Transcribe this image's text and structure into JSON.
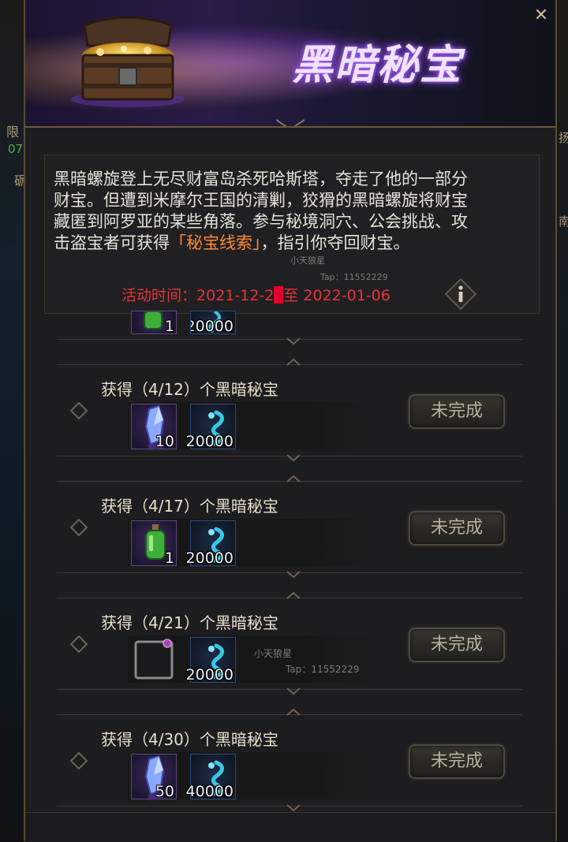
{
  "banner": {
    "title": "黑暗秘宝"
  },
  "background": {
    "left_fragments": [
      "限",
      "07",
      "砺"
    ],
    "right_fragments": [
      "扬",
      "南"
    ]
  },
  "description": {
    "part1": "黑暗螺旋登上无尽财富岛杀死哈斯塔，夺走了他的一部分财宝。但遭到米摩尔王国的清剿，狡猾的黑暗螺旋将财宝藏匿到阿罗亚的某些角落。参与秘境洞穴、公会挑战、攻击盗宝者可获得",
    "highlight": "「秘宝线索」",
    "part2": "，指引你夺回财宝。"
  },
  "event_time": {
    "label": "活动时间：",
    "start": "2021-12-2",
    "separator": "至",
    "end": "2022-01-06"
  },
  "watermarks": [
    {
      "name": "小天狼星",
      "tap": "Tap：11552229"
    },
    {
      "name": "小天狼星",
      "tap": "Tap：11552229"
    }
  ],
  "partial_row": {
    "items": [
      {
        "icon": "green-potion-icon",
        "count": "1"
      },
      {
        "icon": "blue-spirit-icon",
        "count": "20000"
      }
    ]
  },
  "tasks": [
    {
      "title": "获得（4/12）个黑暗秘宝",
      "status": "未完成",
      "items": [
        {
          "icon": "crystal-icon",
          "count": "10"
        },
        {
          "icon": "blue-spirit-icon",
          "count": "20000"
        }
      ]
    },
    {
      "title": "获得（4/17）个黑暗秘宝",
      "status": "未完成",
      "items": [
        {
          "icon": "green-potion-icon",
          "count": "1"
        },
        {
          "icon": "blue-spirit-icon",
          "count": "20000"
        }
      ]
    },
    {
      "title": "获得（4/21）个黑暗秘宝",
      "status": "未完成",
      "items": [
        {
          "icon": "avatar-frame-icon",
          "count": ""
        },
        {
          "icon": "blue-spirit-icon",
          "count": "20000"
        }
      ]
    },
    {
      "title": "获得（4/30）个黑暗秘宝",
      "status": "未完成",
      "items": [
        {
          "icon": "crystal-icon",
          "count": "50"
        },
        {
          "icon": "blue-spirit-icon",
          "count": "40000"
        }
      ]
    }
  ],
  "colors": {
    "panel_bg": "#1d1d1f",
    "gold_border": "#5a4c33",
    "highlight_orange": "#ff8a3a",
    "event_red": "#e5343b",
    "title_purple": "#efe3ff"
  }
}
